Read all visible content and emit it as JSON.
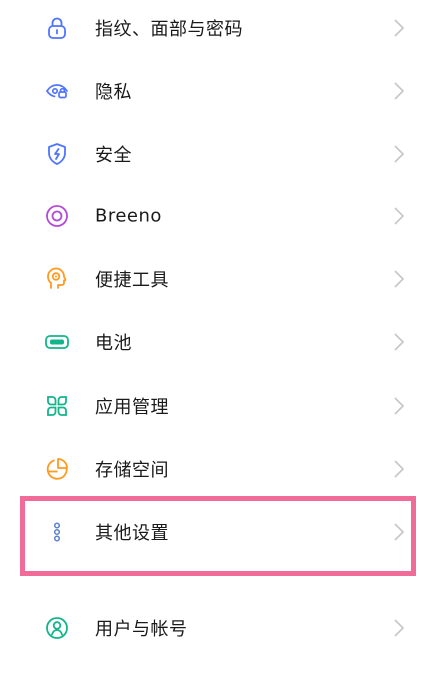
{
  "settings": {
    "items": [
      {
        "label": "指纹、面部与密码",
        "icon": "lock-icon"
      },
      {
        "label": "隐私",
        "icon": "privacy-eye-icon"
      },
      {
        "label": "安全",
        "icon": "security-shield-icon"
      },
      {
        "label": "Breeno",
        "icon": "breeno-icon"
      },
      {
        "label": "便捷工具",
        "icon": "convenience-tools-icon"
      },
      {
        "label": "电池",
        "icon": "battery-icon"
      },
      {
        "label": "应用管理",
        "icon": "app-management-icon"
      },
      {
        "label": "存储空间",
        "icon": "storage-icon"
      },
      {
        "label": "其他设置",
        "icon": "other-settings-icon"
      },
      {
        "label": "用户与帐号",
        "icon": "user-account-icon"
      }
    ]
  },
  "colors": {
    "highlight_border": "#f06b98",
    "lock": "#4f74ff",
    "privacy": "#4f74ff",
    "security": "#4f74ff",
    "breeno": "#b24bd8",
    "tools": "#ff9a1f",
    "battery": "#12b58a",
    "apps": "#12b58a",
    "storage": "#ff9a1f",
    "other": "#5b7fc9",
    "user": "#12b58a",
    "chevron": "#c6c6c6"
  }
}
